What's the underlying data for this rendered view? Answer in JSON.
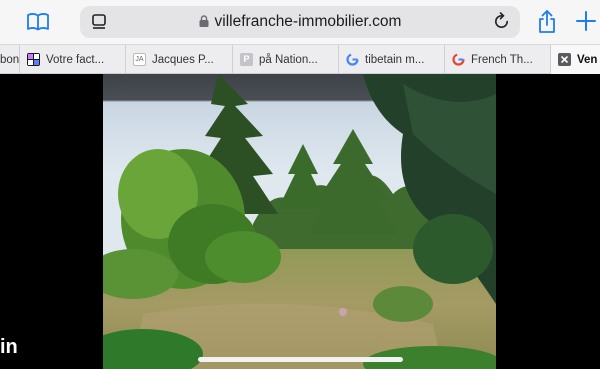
{
  "toolbar": {
    "url": "villefranche-immobilier.com",
    "bookmarks_icon": "book-icon",
    "share_icon": "share-icon",
    "new_tab_icon": "plus-icon",
    "accent_color": "#1e7cf2"
  },
  "tabs": [
    {
      "label": "bon",
      "favicon": ""
    },
    {
      "label": "Votre fact...",
      "favicon": "colorful-grid"
    },
    {
      "label": "Jacques P...",
      "favicon": "JA"
    },
    {
      "label": "på Nation...",
      "favicon": "P"
    },
    {
      "label": "tibetain m...",
      "favicon": "G"
    },
    {
      "label": "French Th...",
      "favicon": "G"
    },
    {
      "label": "Ven",
      "favicon": "close"
    }
  ],
  "content": {
    "side_text": "in",
    "image_description": "garden-with-trees-photo"
  }
}
